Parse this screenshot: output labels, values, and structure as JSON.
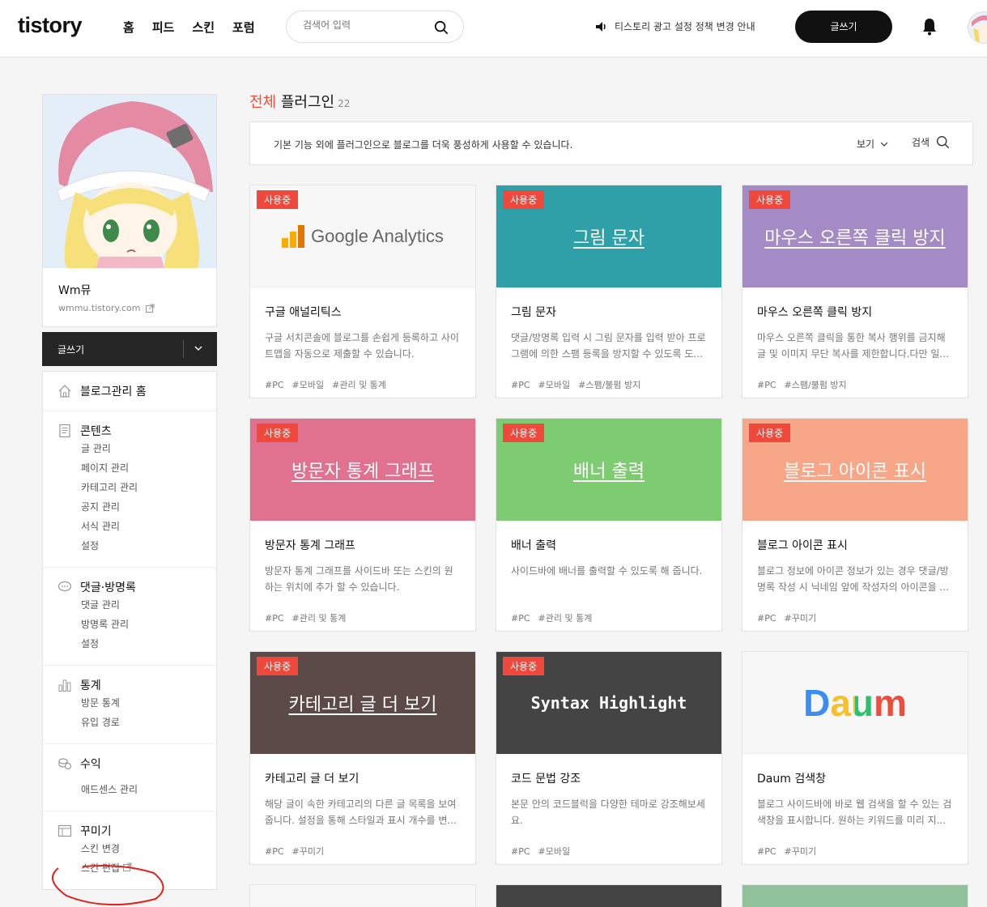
{
  "header": {
    "logo": "tistory",
    "nav": [
      "홈",
      "피드",
      "스킨",
      "포럼"
    ],
    "search_placeholder": "검색어 입력",
    "notice": "티스토리 광고 설정 정책 변경 안내",
    "write_label": "글쓰기"
  },
  "sidebar": {
    "profile_name": "Wm뮤",
    "profile_url": "wmmu.tistory.com",
    "write_label": "글쓰기",
    "sections": [
      {
        "title": "블로그관리 홈",
        "icon": "home-icon",
        "items": []
      },
      {
        "title": "콘텐츠",
        "icon": "document-icon",
        "items": [
          "글 관리",
          "페이지 관리",
          "카테고리 관리",
          "공지 관리",
          "서식 관리",
          "설정"
        ]
      },
      {
        "title": "댓글·방명록",
        "icon": "comment-icon",
        "items": [
          "댓글 관리",
          "방명록 관리",
          "설정"
        ]
      },
      {
        "title": "통계",
        "icon": "chart-icon",
        "items": [
          "방문 통계",
          "유입 경로"
        ]
      },
      {
        "title": "수익",
        "icon": "coins-icon",
        "items": [
          "애드센스 관리"
        ]
      },
      {
        "title": "꾸미기",
        "icon": "layout-icon",
        "items": [
          "스킨 변경",
          "스킨 편집"
        ]
      }
    ]
  },
  "content": {
    "title_accent": "전체",
    "title_rest": " 플러그인",
    "count": "22",
    "description": "기본 기능 외에 플러그인으로 블로그를 더욱 풍성하게 사용할 수 있습니다.",
    "view_label": "보기",
    "search_label": "검색",
    "plugins": [
      {
        "badge": "사용중",
        "thumb_title": "Google Analytics",
        "name": "구글 애널리틱스",
        "desc": "구글 서치콘솔에 블로그를 손쉽게 등록하고 사이트맵을 자동으로 제출할 수 있습니다.",
        "tags": [
          "#PC",
          "#모바일",
          "#관리 및 통계"
        ],
        "color": "#f7f7f7"
      },
      {
        "badge": "사용중",
        "thumb_title": "그림 문자",
        "name": "그림 문자",
        "desc": "댓글/방명록 입력 시 그림 문자를 입력 받아 프로그램에 의한 스팸 등록을 방지할 수 있도록 도...",
        "tags": [
          "#PC",
          "#모바일",
          "#스팸/불펌 방지"
        ],
        "color": "#2fa0a7"
      },
      {
        "badge": "사용중",
        "thumb_title": "마우스 오른쪽 클릭 방지",
        "name": "마우스 오른쪽 클릭 방지",
        "desc": "마우스 오른쪽 클릭을 통한 복사 행위를 금지해 글 및 이미지 무단 복사를 제한합니다.다만 일...",
        "tags": [
          "#PC",
          "#스팸/불펌 방지"
        ],
        "color": "#a48bc6"
      },
      {
        "badge": "사용중",
        "thumb_title": "방문자 통계 그래프",
        "name": "방문자 통계 그래프",
        "desc": "방문자 통계 그래프를 사이드바 또는 스킨의 원하는 위치에 추가 할 수 있습니다.",
        "tags": [
          "#PC",
          "#관리 및 통계"
        ],
        "color": "#e07290"
      },
      {
        "badge": "사용중",
        "thumb_title": "배너 출력",
        "name": "배너 출력",
        "desc": "사이드바에 배너를 출력할 수 있도록 해 줍니다.",
        "tags": [
          "#PC",
          "#관리 및 통계"
        ],
        "color": "#7dcc72"
      },
      {
        "badge": "사용중",
        "thumb_title": "블로그 아이콘 표시",
        "name": "블로그 아이콘 표시",
        "desc": "블로그 정보에 아이콘 정보가 있는 경우 댓글/방명록 작성 시 닉네임 앞에 작성자의 아이콘을 ...",
        "tags": [
          "#PC",
          "#꾸미기"
        ],
        "color": "#f7a687"
      },
      {
        "badge": "사용중",
        "thumb_title": "카테고리 글 더 보기",
        "name": "카테고리 글 더 보기",
        "desc": "해당 글이 속한 카테고리의 다른 글 목록을 보여줍니다. 설정을 통해 스타일과 표시 개수를 변...",
        "tags": [
          "#PC",
          "#꾸미기"
        ],
        "color": "#5b4a48"
      },
      {
        "badge": "사용중",
        "thumb_title": "Syntax Highlight",
        "name": "코드 문법 강조",
        "desc": "본문 안의 코드블럭을 다양한 테마로 강조해보세요.",
        "tags": [
          "#PC",
          "#모바일"
        ],
        "color": "#444444"
      },
      {
        "badge": "",
        "thumb_title": "Daum",
        "name": "Daum 검색창",
        "desc": "블로그 사이드바에 바로 웹 검색을 할 수 있는 검색창을 표시합니다. 원하는 키워드를 미리 지...",
        "tags": [
          "#PC",
          "#꾸미기"
        ],
        "color": "#f7f7f7"
      }
    ]
  },
  "colors": {
    "accent": "#ee4f3d",
    "badge": "#f0493b",
    "dark": "#262626"
  }
}
